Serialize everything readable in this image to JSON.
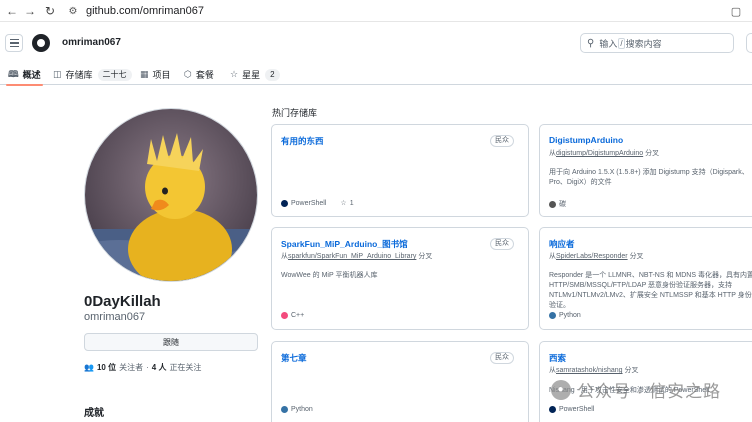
{
  "browser": {
    "url": "github.com/omriman067"
  },
  "header": {
    "username": "omriman067",
    "search_placeholder_prefix": "输入",
    "search_slash": "/",
    "search_placeholder_suffix": "搜索内容"
  },
  "tabs": [
    {
      "label": "概述",
      "icon": "book-icon",
      "active": true
    },
    {
      "label": "存储库",
      "icon": "repo-icon",
      "count": "二十七"
    },
    {
      "label": "项目",
      "icon": "table-icon"
    },
    {
      "label": "套餐",
      "icon": "package-icon"
    },
    {
      "label": "星星",
      "icon": "star-icon",
      "count": "2"
    }
  ],
  "profile": {
    "display_name": "0DayKillah",
    "login": "omriman067",
    "follow_label": "跟随",
    "followers_count": "10 位",
    "followers_label": "关注者",
    "separator": "·",
    "following_count": "4 人",
    "following_label": "正在关注",
    "achievements_title": "成就"
  },
  "popular": {
    "title": "热门存储库",
    "repos": [
      {
        "name": "有用的东西",
        "badge": "民众",
        "fork_prefix": "",
        "fork_source": "",
        "fork_suffix": "",
        "desc": "",
        "language": "PowerShell",
        "lang_color": "#012456",
        "stars": "1"
      },
      {
        "name": "DigistumpArduino",
        "badge": "民众",
        "fork_prefix": "从",
        "fork_source": "digistump/DigistumpArduino",
        "fork_suffix": "分叉",
        "desc": "用于向 Arduino 1.5.X (1.5.8+) 添加 Digistump 支持（Digispark、Pro、DigiX）的文件",
        "language": "碳",
        "lang_color": "#555555",
        "stars": ""
      },
      {
        "name": "SparkFun_MiP_Arduino_图书馆",
        "badge": "民众",
        "fork_prefix": "从",
        "fork_source": "sparkfun/SparkFun_MiP_Arduino_Library",
        "fork_suffix": "分叉",
        "desc": "WowWee 的 MiP 平衡机器人库",
        "language": "C++",
        "lang_color": "#f34b7d",
        "stars": ""
      },
      {
        "name": "响应者",
        "badge": "民众",
        "fork_prefix": "从",
        "fork_source": "SpiderLabs/Responder",
        "fork_suffix": "分叉",
        "desc": "Responder 是一个 LLMNR、NBT-NS 和 MDNS 毒化器，具有内置 HTTP/SMB/MSSQL/FTP/LDAP 恶意身份验证服务器，支持 NTLMv1/NTLMv2/LMv2、扩展安全 NTLMSSP 和基本 HTTP 身份验证。",
        "language": "Python",
        "lang_color": "#3572A5",
        "stars": ""
      },
      {
        "name": "第七章",
        "badge": "民众",
        "fork_prefix": "",
        "fork_source": "",
        "fork_suffix": "",
        "desc": "",
        "language": "Python",
        "lang_color": "#3572A5",
        "stars": ""
      },
      {
        "name": "西索",
        "badge": "民众",
        "fork_prefix": "从",
        "fork_source": "samratashok/nishang",
        "fork_suffix": "分叉",
        "desc": "Nishang - 用于攻击性安全和渗透测试的 PowerShell",
        "language": "PowerShell",
        "lang_color": "#012456",
        "stars": ""
      }
    ]
  },
  "watermark": {
    "text": "公众号 · 信安之路"
  }
}
